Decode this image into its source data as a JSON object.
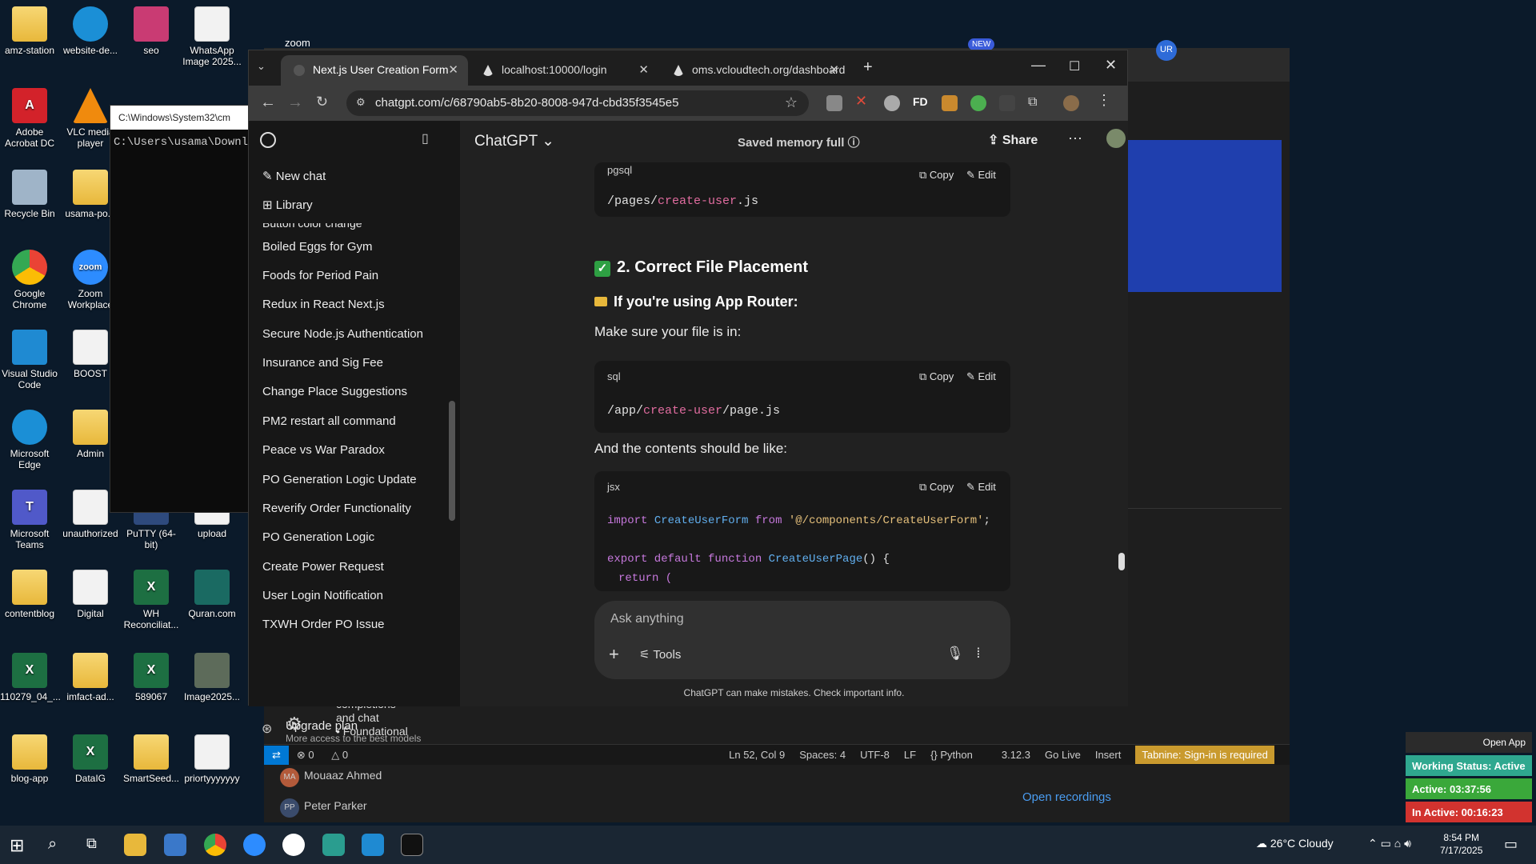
{
  "desktop": {
    "icons": [
      {
        "label": "amz-station"
      },
      {
        "label": "website-de..."
      },
      {
        "label": "seo"
      },
      {
        "label": "WhatsApp Image 2025..."
      },
      {
        "label": "Adobe Acrobat DC"
      },
      {
        "label": "VLC media player"
      },
      {
        "label": "Recycle Bin"
      },
      {
        "label": "usama-po..."
      },
      {
        "label": "Google Chrome"
      },
      {
        "label": "Zoom Workplace"
      },
      {
        "label": "Visual Studio Code"
      },
      {
        "label": "BOOST"
      },
      {
        "label": "Microsoft Edge"
      },
      {
        "label": "Admin"
      },
      {
        "label": "Microsoft Teams"
      },
      {
        "label": "unauthorized"
      },
      {
        "label": "PuTTY (64-bit)"
      },
      {
        "label": "upload"
      },
      {
        "label": "contentblog"
      },
      {
        "label": "Digital"
      },
      {
        "label": "WH Reconciliat..."
      },
      {
        "label": "Quran.com"
      },
      {
        "label": "110279_04_..."
      },
      {
        "label": "imfact-ad..."
      },
      {
        "label": "589067"
      },
      {
        "label": "Image2025..."
      },
      {
        "label": "blog-app"
      },
      {
        "label": "DataIG"
      },
      {
        "label": "SmartSeed..."
      },
      {
        "label": "priortyyyyyyy"
      }
    ]
  },
  "cmd": {
    "title": "C:\\Windows\\System32\\cm",
    "line": "C:\\Users\\usama\\Downlo"
  },
  "zoom_label": "zoom",
  "new_badge": "NEW",
  "avatar_initials": "UR",
  "chrome": {
    "tabs": [
      {
        "label": "Next.js User Creation Form",
        "active": true
      },
      {
        "label": "localhost:10000/login",
        "active": false
      },
      {
        "label": "oms.vcloudtech.org/dashboard",
        "active": false
      }
    ],
    "url": "chatgpt.com/c/68790ab5-8b20-8008-947d-cbd35f3545e5",
    "ext_fd": "FD"
  },
  "chatgpt": {
    "header": {
      "model": "ChatGPT",
      "memory": "Saved memory full",
      "share": "Share"
    },
    "sidebar": {
      "new_chat": "New chat",
      "library": "Library",
      "cut_item": "Button color change",
      "history": [
        "Boiled Eggs for Gym",
        "Foods for Period Pain",
        "Redux in React Next.js",
        "Secure Node.js Authentication",
        "Insurance and Sig Fee",
        "Change Place Suggestions",
        "PM2 restart all command",
        "Peace vs War Paradox",
        "PO Generation Logic Update",
        "Reverify Order Functionality",
        "PO Generation Logic",
        "Create Power Request",
        "User Login Notification",
        "TXWH Order PO Issue"
      ],
      "upgrade_title": "Upgrade plan",
      "upgrade_sub": "More access to the best models"
    },
    "content": {
      "block1_lang": "pgsql",
      "block1_code_a": "/pages/",
      "block1_code_b": "create-user",
      "block1_code_c": ".js",
      "copy": "Copy",
      "edit": "Edit",
      "heading2": "2. Correct File Placement",
      "heading3": "If you're using App Router:",
      "para1": "Make sure your file is in:",
      "block2_lang": "sql",
      "block2_code_a": "/app/",
      "block2_code_b": "create-user",
      "block2_code_c": "/page.js",
      "para2": "And the contents should be like:",
      "block3_lang": "jsx",
      "code_import": "import",
      "code_component": "CreateUserForm",
      "code_from": "from",
      "code_path": "'@/components/CreateUserForm'",
      "code_semicolon": ";",
      "code_export": "export default function",
      "code_fname": "CreateUserPage",
      "code_paren": "() {",
      "code_return": "return (",
      "composer_placeholder": "Ask anything",
      "tools": "Tools",
      "disclaimer": "ChatGPT can make mistakes. Check important info."
    }
  },
  "vscode": {
    "sidebar_snippet": [
      "completions",
      "and chat"
    ],
    "bullet": "Foundational",
    "status": {
      "errors": "0",
      "warnings": "0",
      "position": "Ln 52, Col 9",
      "spaces": "Spaces: 4",
      "encoding": "UTF-8",
      "eol": "LF",
      "language": "Python",
      "version": "3.12.3",
      "golive": "Go Live",
      "insert": "Insert",
      "tabnine": "Tabnine: Sign-in is required"
    }
  },
  "teams": {
    "people": [
      {
        "initials": "MA",
        "name": "Mouaaz Ahmed"
      },
      {
        "initials": "PP",
        "name": "Peter Parker"
      }
    ],
    "recordings": "Open recordings"
  },
  "widget": {
    "open_app": "Open App",
    "status": "Working Status: Active",
    "active": "Active: 03:37:56",
    "inactive": "In Active: 00:16:23"
  },
  "taskbar": {
    "weather": "26°C  Cloudy",
    "time": "8:54 PM",
    "date": "7/17/2025"
  }
}
